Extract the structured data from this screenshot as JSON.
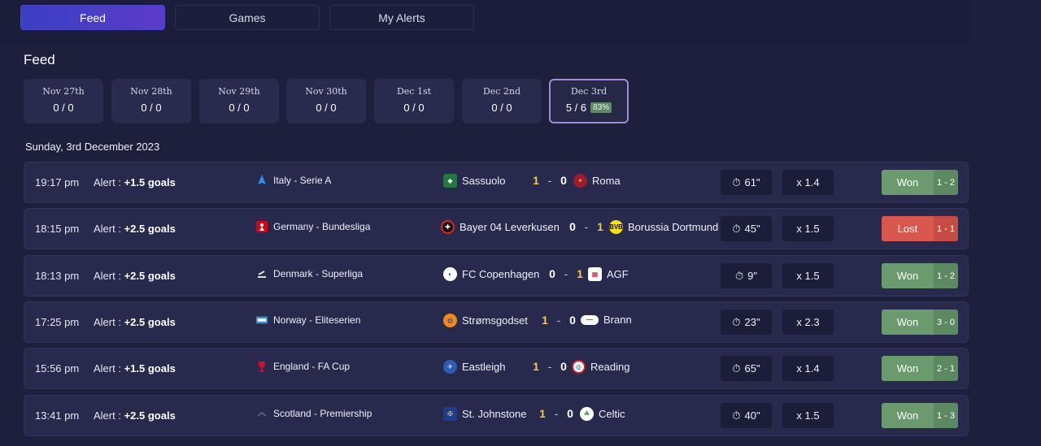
{
  "nav": {
    "tabs": [
      {
        "label": "Feed",
        "active": true
      },
      {
        "label": "Games",
        "active": false
      },
      {
        "label": "My Alerts",
        "active": false
      }
    ]
  },
  "feed": {
    "title": "Feed",
    "dates": [
      {
        "label": "Nov 27th",
        "score": "0 / 0"
      },
      {
        "label": "Nov 28th",
        "score": "0 / 0"
      },
      {
        "label": "Nov 29th",
        "score": "0 / 0"
      },
      {
        "label": "Nov 30th",
        "score": "0 / 0"
      },
      {
        "label": "Dec 1st",
        "score": "0 / 0"
      },
      {
        "label": "Dec 2nd",
        "score": "0 / 0"
      },
      {
        "label": "Dec 3rd",
        "score": "5 / 6",
        "pct": "83%",
        "active": true
      }
    ],
    "day_heading": "Sunday, 3rd December 2023",
    "alert_label": "Alert :",
    "rows": [
      {
        "time": "19:17 pm",
        "alert": "+1.5 goals",
        "league": "Italy - Serie A",
        "home": "Sassuolo",
        "home_goals": "1",
        "away_goals": "0",
        "away": "Roma",
        "minute": "61\"",
        "odds": "x 1.4",
        "result": "Won",
        "final": "1 - 2"
      },
      {
        "time": "18:15 pm",
        "alert": "+2.5 goals",
        "league": "Germany - Bundesliga",
        "home": "Bayer 04 Leverkusen",
        "home_goals": "0",
        "away_goals": "1",
        "away": "Borussia Dortmund",
        "minute": "45\"",
        "odds": "x 1.5",
        "result": "Lost",
        "final": "1 - 1"
      },
      {
        "time": "18:13 pm",
        "alert": "+2.5 goals",
        "league": "Denmark - Superliga",
        "home": "FC Copenhagen",
        "home_goals": "0",
        "away_goals": "1",
        "away": "AGF",
        "minute": "9\"",
        "odds": "x 1.5",
        "result": "Won",
        "final": "1 - 2"
      },
      {
        "time": "17:25 pm",
        "alert": "+2.5 goals",
        "league": "Norway - Eliteserien",
        "home": "Strømsgodset",
        "home_goals": "1",
        "away_goals": "0",
        "away": "Brann",
        "minute": "23\"",
        "odds": "x 2.3",
        "result": "Won",
        "final": "3 - 0"
      },
      {
        "time": "15:56 pm",
        "alert": "+1.5 goals",
        "league": "England - FA Cup",
        "home": "Eastleigh",
        "home_goals": "1",
        "away_goals": "0",
        "away": "Reading",
        "minute": "65\"",
        "odds": "x 1.4",
        "result": "Won",
        "final": "2 - 1"
      },
      {
        "time": "13:41 pm",
        "alert": "+2.5 goals",
        "league": "Scotland - Premiership",
        "home": "St. Johnstone",
        "home_goals": "1",
        "away_goals": "0",
        "away": "Celtic",
        "minute": "40\"",
        "odds": "x 1.5",
        "result": "Won",
        "final": "1 - 3"
      }
    ]
  },
  "colors": {
    "won": "#6a9a6e",
    "lost": "#d9574f",
    "score_highlight": "#f4c64a",
    "accent": "#4a46c8"
  }
}
